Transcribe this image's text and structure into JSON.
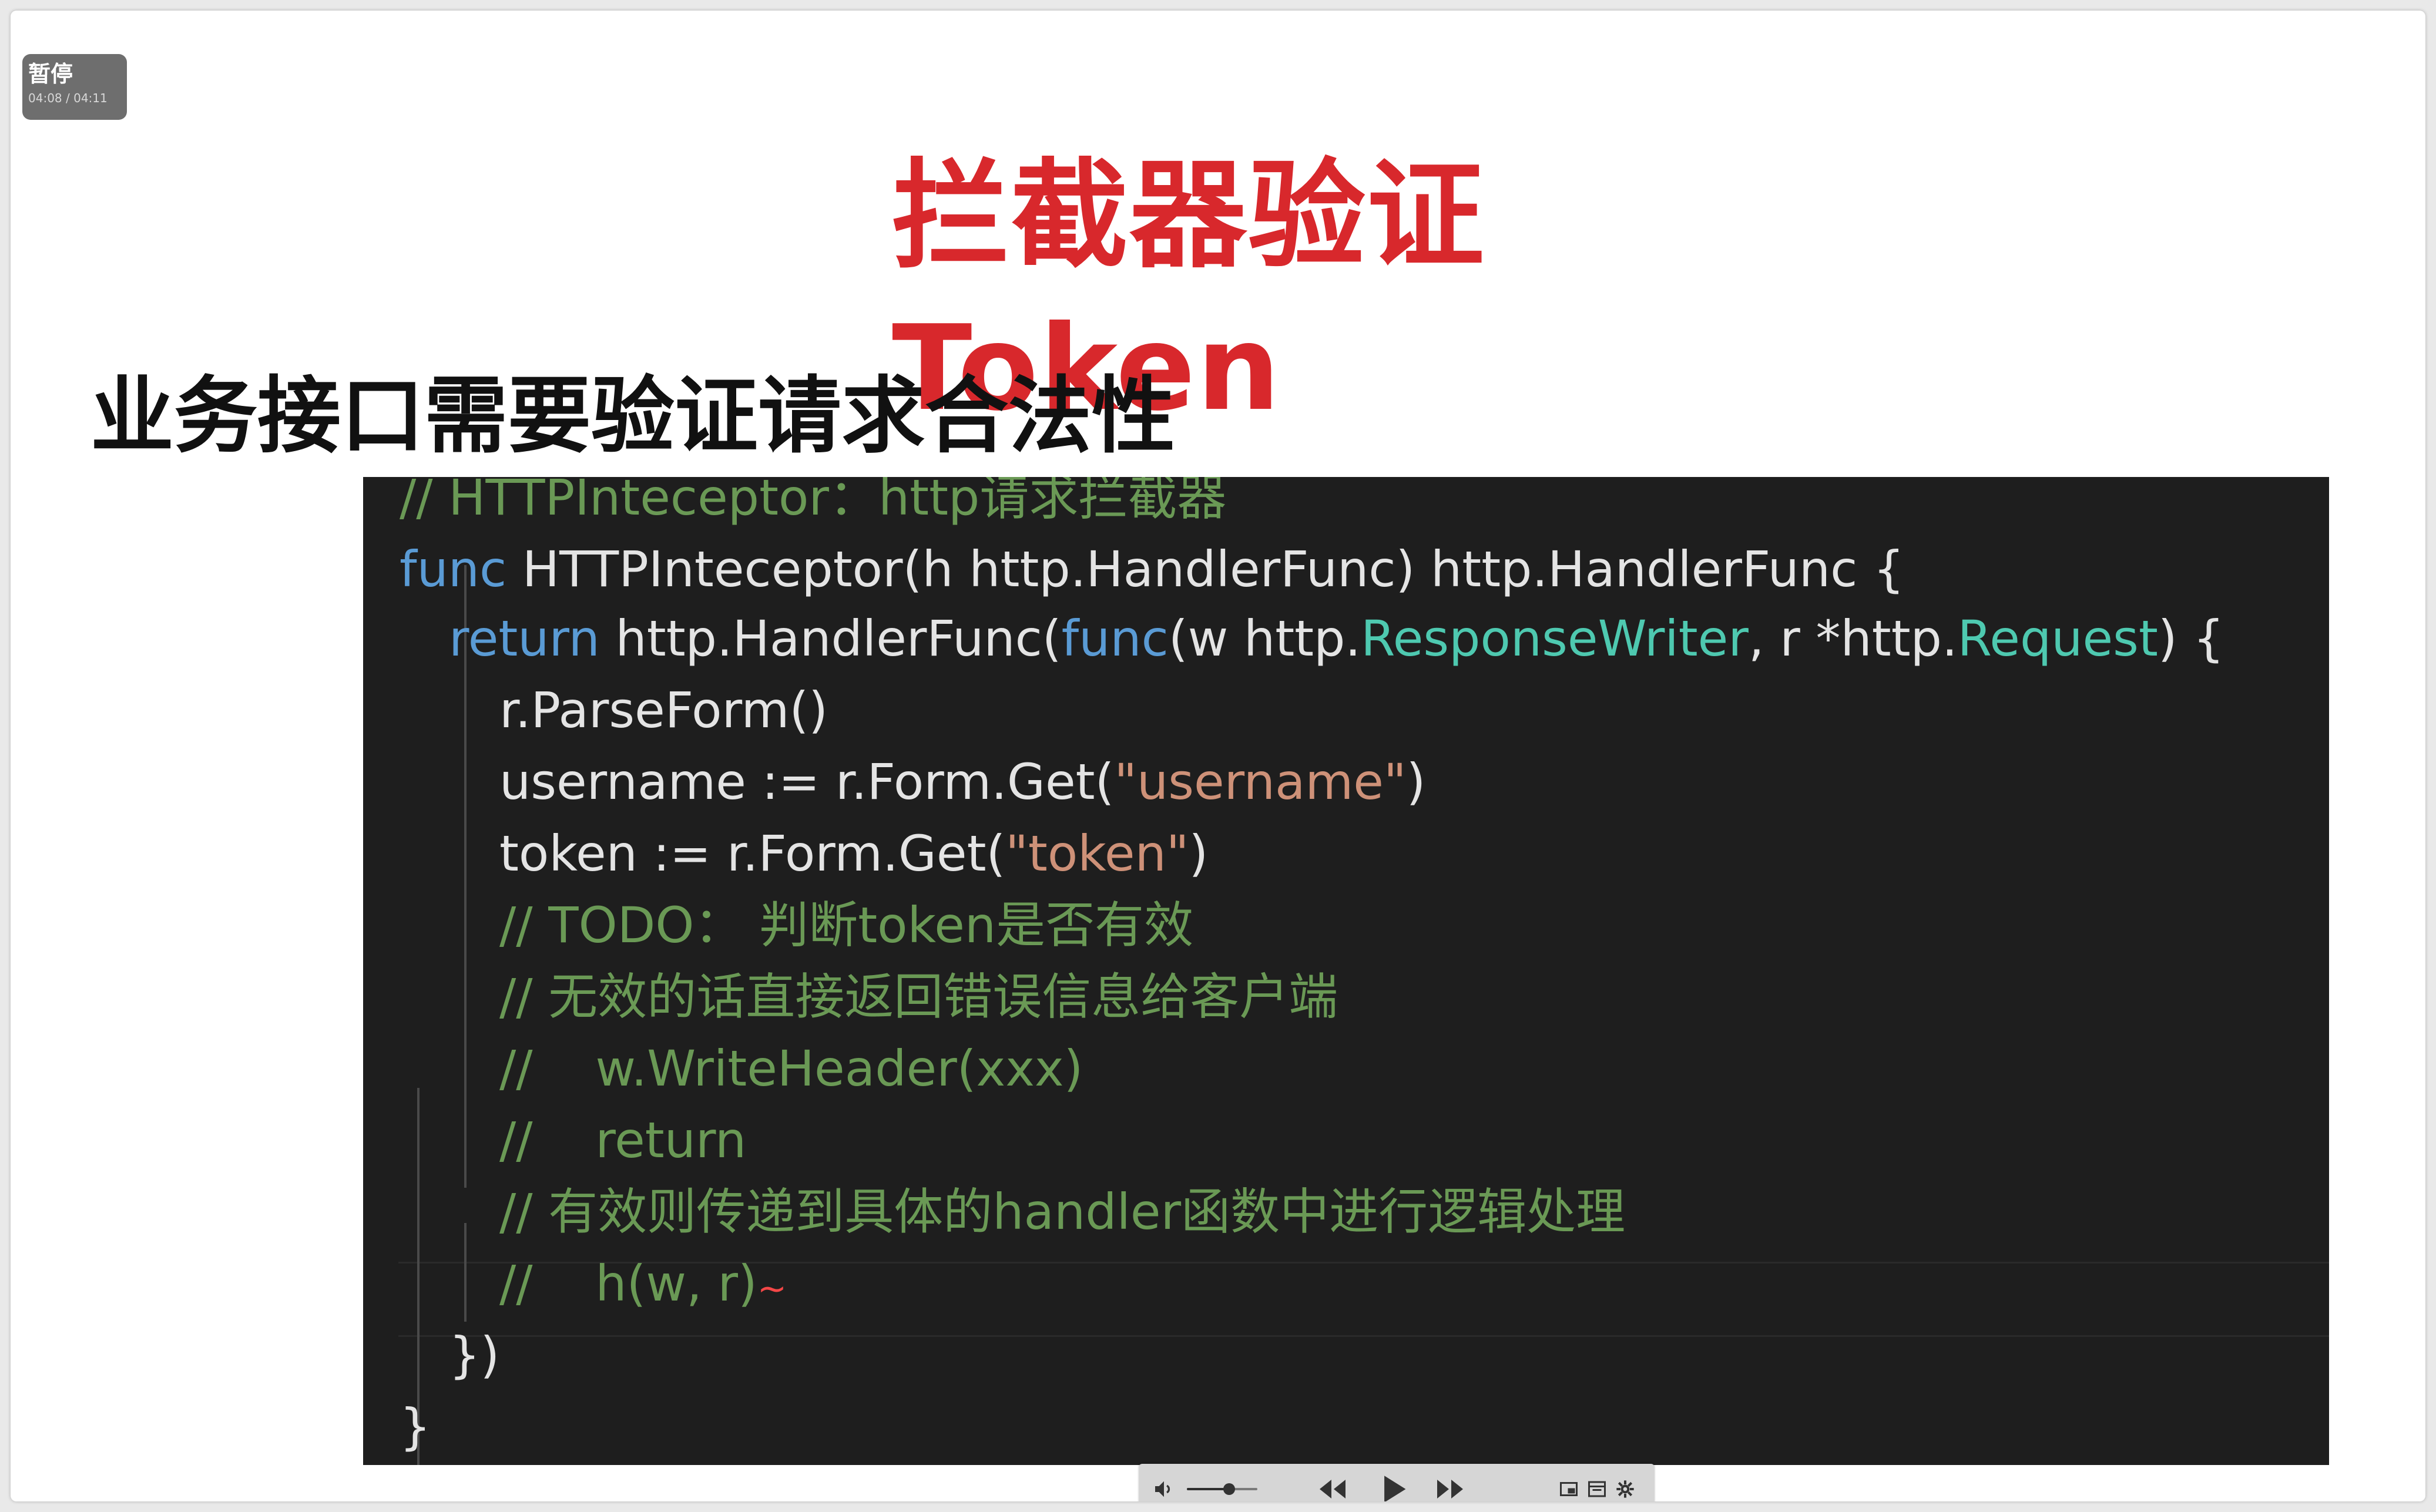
{
  "status": {
    "label": "暂停",
    "time": "04:08 / 04:11"
  },
  "slide": {
    "title": "拦截器验证Token",
    "subtitle": "业务接口需要验证请求合法性"
  },
  "code": {
    "l1": "// HTTPInteceptor：http请求拦截器",
    "l2_kw": "func",
    "l2_rest": " HTTPInteceptor(h http.HandlerFunc) http.HandlerFunc {",
    "l3_kw": "return",
    "l3_a": " http.HandlerFunc(",
    "l3_kw2": "func",
    "l3_b": "(w http.",
    "l3_t1": "ResponseWriter",
    "l3_c": ", r *http.",
    "l3_t2": "Request",
    "l3_d": ") {",
    "l4": "r.ParseForm()",
    "l5_a": "username := r.Form.Get(",
    "l5_s": "\"username\"",
    "l5_b": ")",
    "l6_a": "token := r.Form.Get(",
    "l6_s": "\"token\"",
    "l6_b": ")",
    "l7": "// TODO： 判断token是否有效",
    "l8": "// 无效的话直接返回错误信息给客户端",
    "l9": "//    w.WriteHeader(xxx)",
    "l10": "//    return",
    "l11": "// 有效则传递到具体的handler函数中进行逻辑处理",
    "l12": "//    h(w, r)",
    "l13": "})",
    "l14": "}"
  },
  "player": {
    "volume_level": 0.6,
    "icons": [
      "volume-icon",
      "rewind-icon",
      "play-icon",
      "fast-forward-icon",
      "pip-icon",
      "window-icon",
      "settings-icon"
    ]
  },
  "colors": {
    "title": "#d8282c",
    "keyword": "#5a9bd5",
    "type": "#4ec9b0",
    "string": "#ce9178",
    "comment": "#6a9955",
    "editor_bg": "#1e1e1e"
  }
}
